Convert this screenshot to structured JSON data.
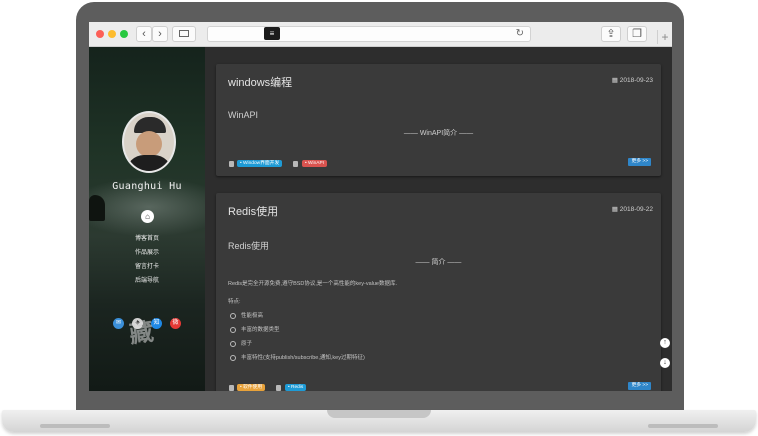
{
  "browser": {
    "back_icon": "chevron-left",
    "forward_icon": "chevron-right",
    "sidebar_icon": "sidebar-toggle",
    "reload_icon": "reload",
    "share_icon": "share",
    "tabs_icon": "tabs",
    "new_tab_icon": "plus"
  },
  "sidebar": {
    "name": "Guanghui Hu",
    "menu": [
      "博客首页",
      "作品展示",
      "留言打卡",
      "后端导航"
    ],
    "calligraphy": "藏"
  },
  "posts": [
    {
      "title": "windows编程",
      "date": "2018-09-23",
      "subtitle": "WinAPI",
      "center_heading": "—— WinAPI简介 ——",
      "tags_left": [
        "• Window界面开发"
      ],
      "tags_right": [
        "• WinAPI"
      ],
      "more": "更多 >>"
    },
    {
      "title": "Redis使用",
      "date": "2018-09-22",
      "subtitle": "Redis使用",
      "center_heading": "—— 简介 ——",
      "intro": "Redis是完全开源免费,遵守BSD协议,是一个高性能的key-value数据库.",
      "features_label": "特点:",
      "features": [
        "性能极高",
        "丰富的数据类型",
        "原子",
        "丰富特性(支持publish/subscribe,通知,key过期特征)"
      ],
      "tags_left": [
        "• 软件使用"
      ],
      "tags_right": [
        "• Redis"
      ],
      "more": "更多 >>"
    }
  ],
  "colors": {
    "tag_blue": "#1e9bd6",
    "tag_red": "#d9534f",
    "tag_orange": "#e8a23a",
    "more_blue": "#2f86c9"
  }
}
